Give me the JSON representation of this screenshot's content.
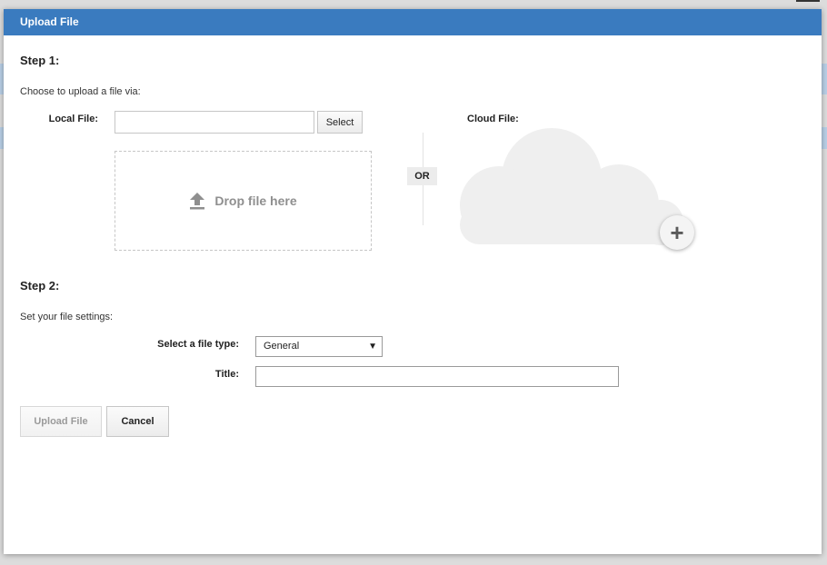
{
  "dialog": {
    "title": "Upload File"
  },
  "step1": {
    "heading": "Step 1:",
    "description": "Choose to upload a file via:",
    "local_file_label": "Local File:",
    "local_file_value": "",
    "select_button": "Select",
    "drop_text": "Drop file here",
    "or_text": "OR",
    "cloud_file_label": "Cloud File:"
  },
  "step2": {
    "heading": "Step 2:",
    "description": "Set your file settings:",
    "file_type_label": "Select a file type:",
    "file_type_value": "General",
    "title_label": "Title:",
    "title_value": ""
  },
  "actions": {
    "upload_label": "Upload File",
    "cancel_label": "Cancel"
  },
  "icons": {
    "upload": "upload-arrow-icon",
    "add": "plus-icon",
    "dropdown": "caret-down-icon"
  },
  "colors": {
    "titlebar": "#3a7bbf",
    "cloud": "#efefef"
  }
}
